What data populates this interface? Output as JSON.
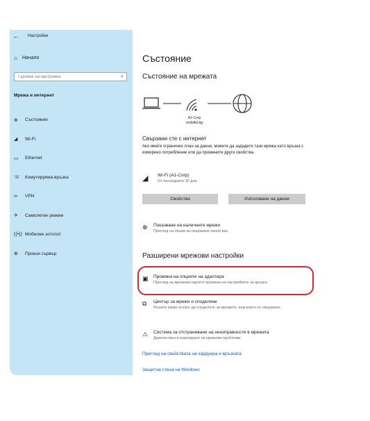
{
  "window": {
    "title": "Настройки"
  },
  "sidebar": {
    "home_label": "Начало",
    "search_placeholder": "Търсене на настройка",
    "section_title": "Мрежа и интернет",
    "items": [
      {
        "label": "Състояние",
        "icon": "globe-status-icon"
      },
      {
        "label": "Wi-Fi",
        "icon": "wifi-icon"
      },
      {
        "label": "Ethernet",
        "icon": "ethernet-icon"
      },
      {
        "label": "Комутируема връзка",
        "icon": "phone-icon"
      },
      {
        "label": "VPN",
        "icon": "vpn-icon"
      },
      {
        "label": "Самолетен режим",
        "icon": "airplane-icon"
      },
      {
        "label": "Мобилен хотспот",
        "icon": "hotspot-icon"
      },
      {
        "label": "Прокси сървър",
        "icon": "globe-icon"
      }
    ]
  },
  "main": {
    "page_title": "Състояние",
    "network_status_title": "Състояние на мрежата",
    "network_name": "A1-Corp",
    "network_host": "mobiltel.bg",
    "connected_title": "Свързани сте с интернет",
    "connected_desc": "Ако имате ограничен план за данни, можете да зададете тази мрежа като връзка с измерено потребление или да промените други свойства.",
    "wifi_name": "Wi-Fi (A1-Corp)",
    "wifi_sub": "От последните 30 дни",
    "properties_button": "Свойства",
    "data_usage_button": "Използване на данни",
    "show_networks_title": "Показване на наличните мрежи",
    "show_networks_desc": "Преглед на опции за свързване около вас.",
    "advanced_title": "Разширени мрежови настройки",
    "adapter_title": "Промяна на опциите на адаптера",
    "adapter_desc": "Преглед на мрежови карти и промяна на настройките за връзка.",
    "sharing_title": "Център за мрежи и споделяне",
    "sharing_desc": "Решете какво искате да споделяте за мрежите, към които се свързвате.",
    "troubleshoot_title": "Система за отстраняване на неизправности в мрежата",
    "troubleshoot_desc": "Диагностика и коригиране на мрежови проблеми.",
    "hw_link": "Преглед на свойствата на хардуера и връзката",
    "firewall_link": "Защитна стена на Windows"
  },
  "colors": {
    "sidebar_bg": "#c4e5f6",
    "link": "#0a5dbd",
    "highlight": "#d6262e",
    "button_bg": "#cccccc"
  }
}
